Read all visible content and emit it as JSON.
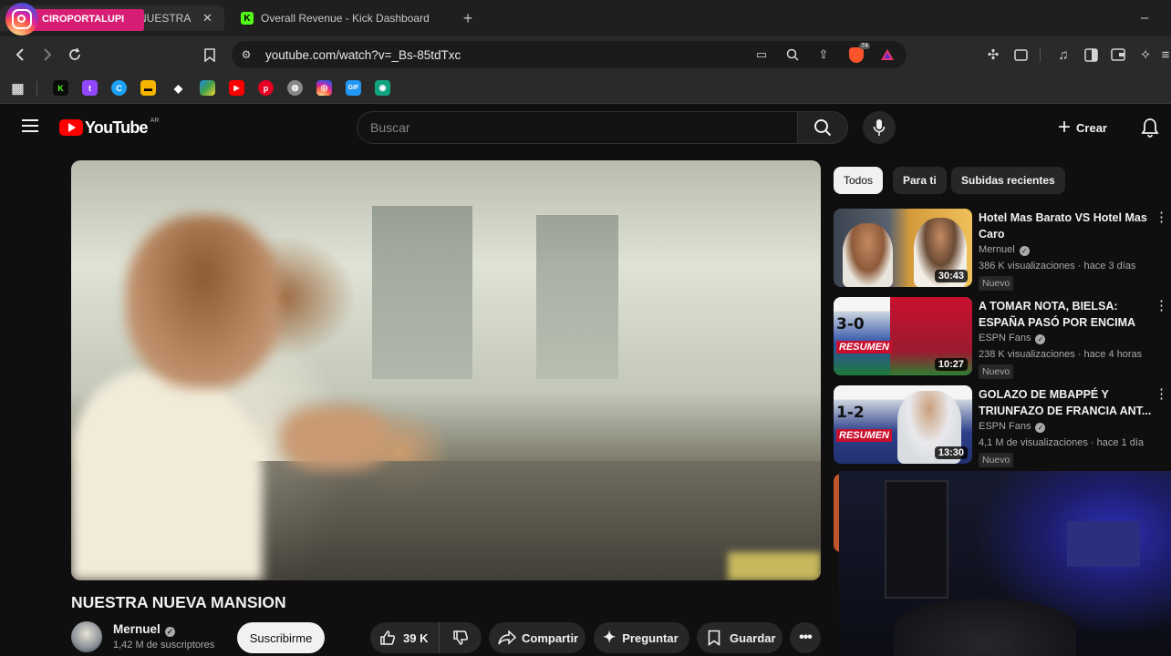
{
  "overlay": {
    "streamer_handle": "CIROPORTALUPI"
  },
  "tabs": [
    {
      "title": "NUESTRA NUEVA MANSION - Yo"
    },
    {
      "title": "Overall Revenue - Kick Dashboard"
    }
  ],
  "toolbar": {
    "url": "youtube.com/watch?v=_Bs-85tdTxc",
    "brave_badge": "74"
  },
  "youtube": {
    "logo_text": "YouTube",
    "country_code": "AR",
    "search_placeholder": "Buscar",
    "create_label": "Crear"
  },
  "video": {
    "title": "NUESTRA NUEVA MANSION",
    "channel": "Mernuel",
    "subscribers": "1,42 M de suscriptores",
    "subscribe_label": "Suscribirme",
    "likes": "39 K",
    "share_label": "Compartir",
    "ask_label": "Preguntar",
    "save_label": "Guardar"
  },
  "filters": [
    "Todos",
    "Para ti",
    "Subidas recientes"
  ],
  "recommendations": [
    {
      "title": "Hotel Mas Barato VS Hotel Mas Caro",
      "channel": "Mernuel",
      "meta": "386 K visualizaciones · hace 3 días",
      "badge": "Nuevo",
      "duration": "30:43"
    },
    {
      "title": "A TOMAR NOTA, BIELSA: ESPAÑA PASÓ POR ENCIMA A...",
      "channel": "ESPN Fans",
      "meta": "238 K visualizaciones · hace 4 horas",
      "badge": "Nuevo",
      "duration": "10:27",
      "score": "3-0",
      "thumb_caption": "RESUMEN"
    },
    {
      "title": "GOLAZO DE MBAPPÉ Y TRIUNFAZO DE FRANCIA ANT...",
      "channel": "ESPN Fans",
      "meta": "4,1 M de visualizaciones · hace 1 día",
      "badge": "Nuevo",
      "duration": "13:30",
      "score": "1-2",
      "thumb_caption": "RESUMEN"
    }
  ],
  "colors": {
    "youtube_red": "#ff0000",
    "kick_green": "#53fc18",
    "background": "#0f0f0f"
  }
}
